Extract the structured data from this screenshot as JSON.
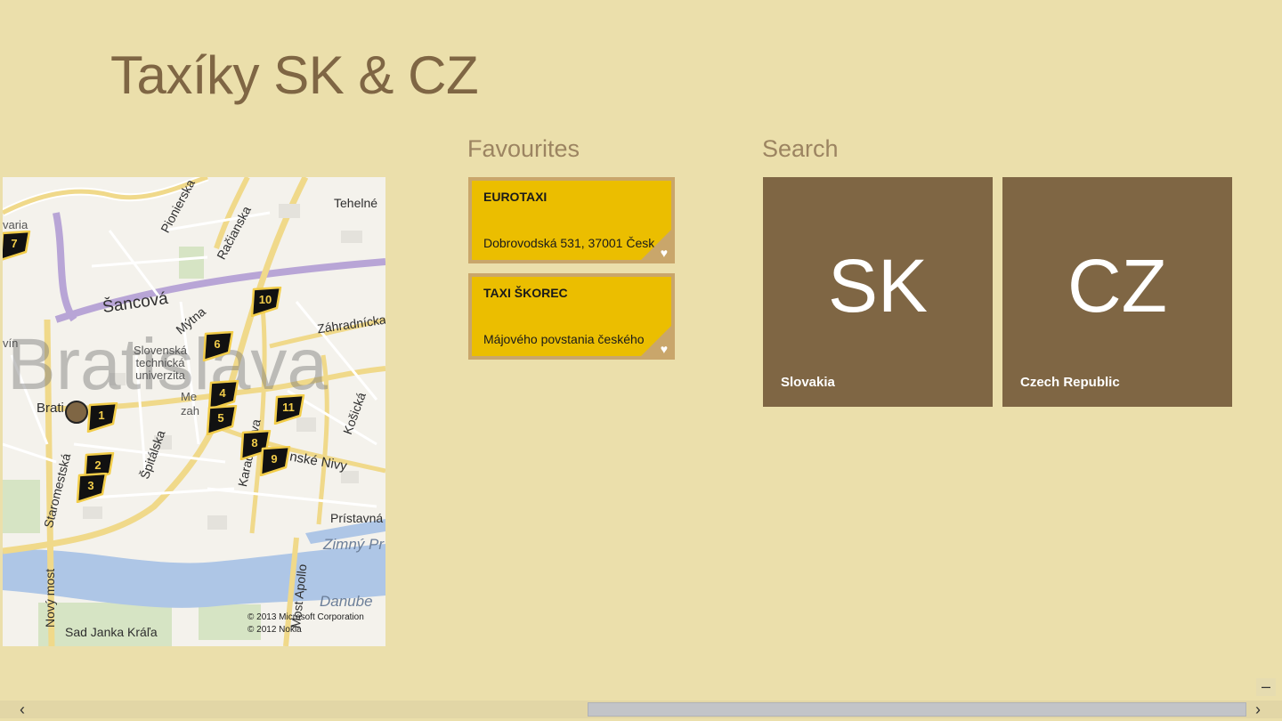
{
  "app": {
    "title": "Taxíky SK & CZ"
  },
  "map": {
    "labels": {
      "pionierska": "Pionierska",
      "racianska": "Račianska",
      "tehelne": "Tehelné",
      "sancova": "Šancová",
      "mytna": "Mýtna",
      "zahradnicka": "Záhradnícka",
      "stu": "Slovenská technická univerzita",
      "bratislava": "Bratislava",
      "brati": "Brati",
      "mez": "Me",
      "zah": "zah",
      "spitalska": "Špitálska",
      "staromestska": "Staromestská",
      "kosicka": "Košická",
      "karadzicova": "Karadžičova",
      "nivy": "nské Nivy",
      "pristavna": "Prístavná",
      "zimny": "Zimný Pr",
      "danube": "Danube",
      "novy_most": "Nový most",
      "most_apollo": "Most Apollo",
      "sad": "Sad Janka Kráľa",
      "vin": "vín",
      "varia": "varia"
    },
    "copyright_line1": "© 2013 Microsoft Corporation",
    "copyright_line2": "© 2012 Nokia",
    "pins": [
      "1",
      "2",
      "3",
      "4",
      "5",
      "6",
      "7",
      "8",
      "9",
      "10",
      "11"
    ]
  },
  "favourites": {
    "title": "Favourites",
    "items": [
      {
        "name": "EUROTAXI",
        "address": "Dobrovodská 531, 37001 Česk"
      },
      {
        "name": "TAXI ŠKOREC",
        "address": "Májového povstania českého"
      }
    ]
  },
  "search": {
    "title": "Search",
    "tiles": [
      {
        "code": "SK",
        "name": "Slovakia"
      },
      {
        "code": "CZ",
        "name": "Czech Republic"
      }
    ]
  },
  "icons": {
    "heart": "heart-icon",
    "scroll_left": "chevron-left-icon",
    "scroll_right": "chevron-right-icon",
    "zoom_out": "minus-icon"
  },
  "colors": {
    "background": "#ebdfab",
    "accent_brown": "#7f6644",
    "favourite_yellow": "#ebbe00",
    "favourite_border": "#c9a66b"
  }
}
